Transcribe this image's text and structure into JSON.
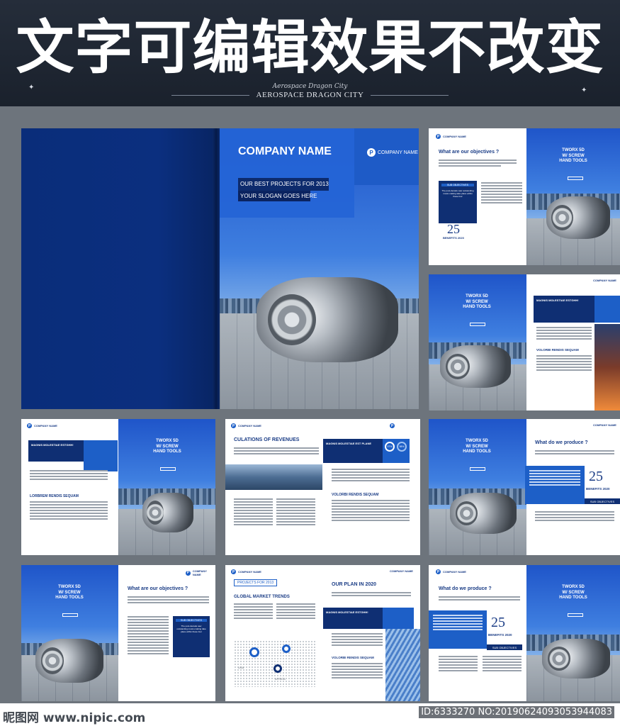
{
  "header": {
    "headline": "文字可编辑效果不改变",
    "brand_script": "Aerospace Dragon City",
    "brand_main": "AEROSPACE DRAGON CITY"
  },
  "cover": {
    "company_name": "COMPANY NAME",
    "logo_text": "COMPANY NAME",
    "projects": "OUR BEST PROJECTS FOR 2013",
    "slogan": "YOUR SLOGAN GOES HERE"
  },
  "spreads": {
    "logo_text": "COMPANY NAME",
    "objectives_title": "What are our objectives ?",
    "sub_objectives": "SUB OBJECTIVES",
    "objectives_body": "The post-decade saw outstanding music-making take place within these four",
    "benefits_num": "25",
    "benefits_label": "BENEFITS 2020",
    "tools_title": "TWORX 5D\nW/ SCREW\nHAND TOOLS",
    "magnis": "MAGNIS MOLESTIAE EST PLANE",
    "magnis_alt": "MAGNIS MOLESTIAE ESTGHH!",
    "volorbi": "VOLORBI RENDIS SEQUAM",
    "lorem_heading": "LORBREM RENDIS SEQUAM",
    "revenues_title": "CULATIONS OF REVENUES",
    "percent_a": "97%",
    "percent_b": "98%",
    "produce_title": "What do we produce ?",
    "projects_2013": "PROJECTS FOR 2013",
    "global_trends": "GLOBAL MARKET TRENDS",
    "plan_title": "OUR PLAN IN 2020",
    "africa": "AFRICA",
    "usa": "USA"
  },
  "footer": {
    "site": "昵图网 www.nipic.com",
    "id": "ID:6333270 NO:20190624093053944083"
  },
  "colors": {
    "navy": "#0f2f73",
    "brand_blue": "#1d5fc7",
    "header_bg": "#1f2733",
    "backdrop": "#6d747c"
  }
}
